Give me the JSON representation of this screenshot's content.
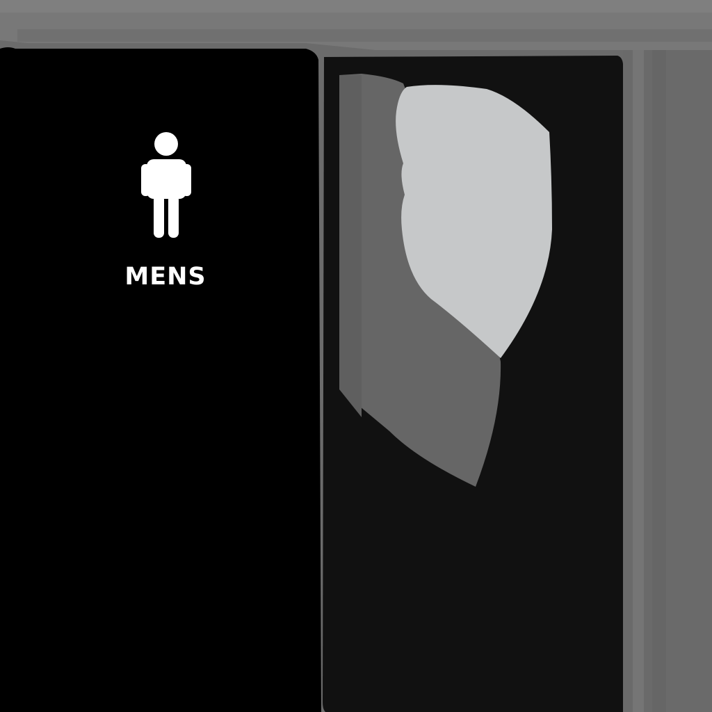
{
  "sign": {
    "label": "MENS",
    "icon": "male-restroom-icon"
  },
  "colors": {
    "wall": "#6b6b6b",
    "frame_top": "#7a7a7a",
    "left_panel": "#000000",
    "right_panel": "#111111",
    "mirror_light": "#c6c8c9",
    "mirror_dark": "#676767",
    "sign_text": "#ffffff"
  }
}
